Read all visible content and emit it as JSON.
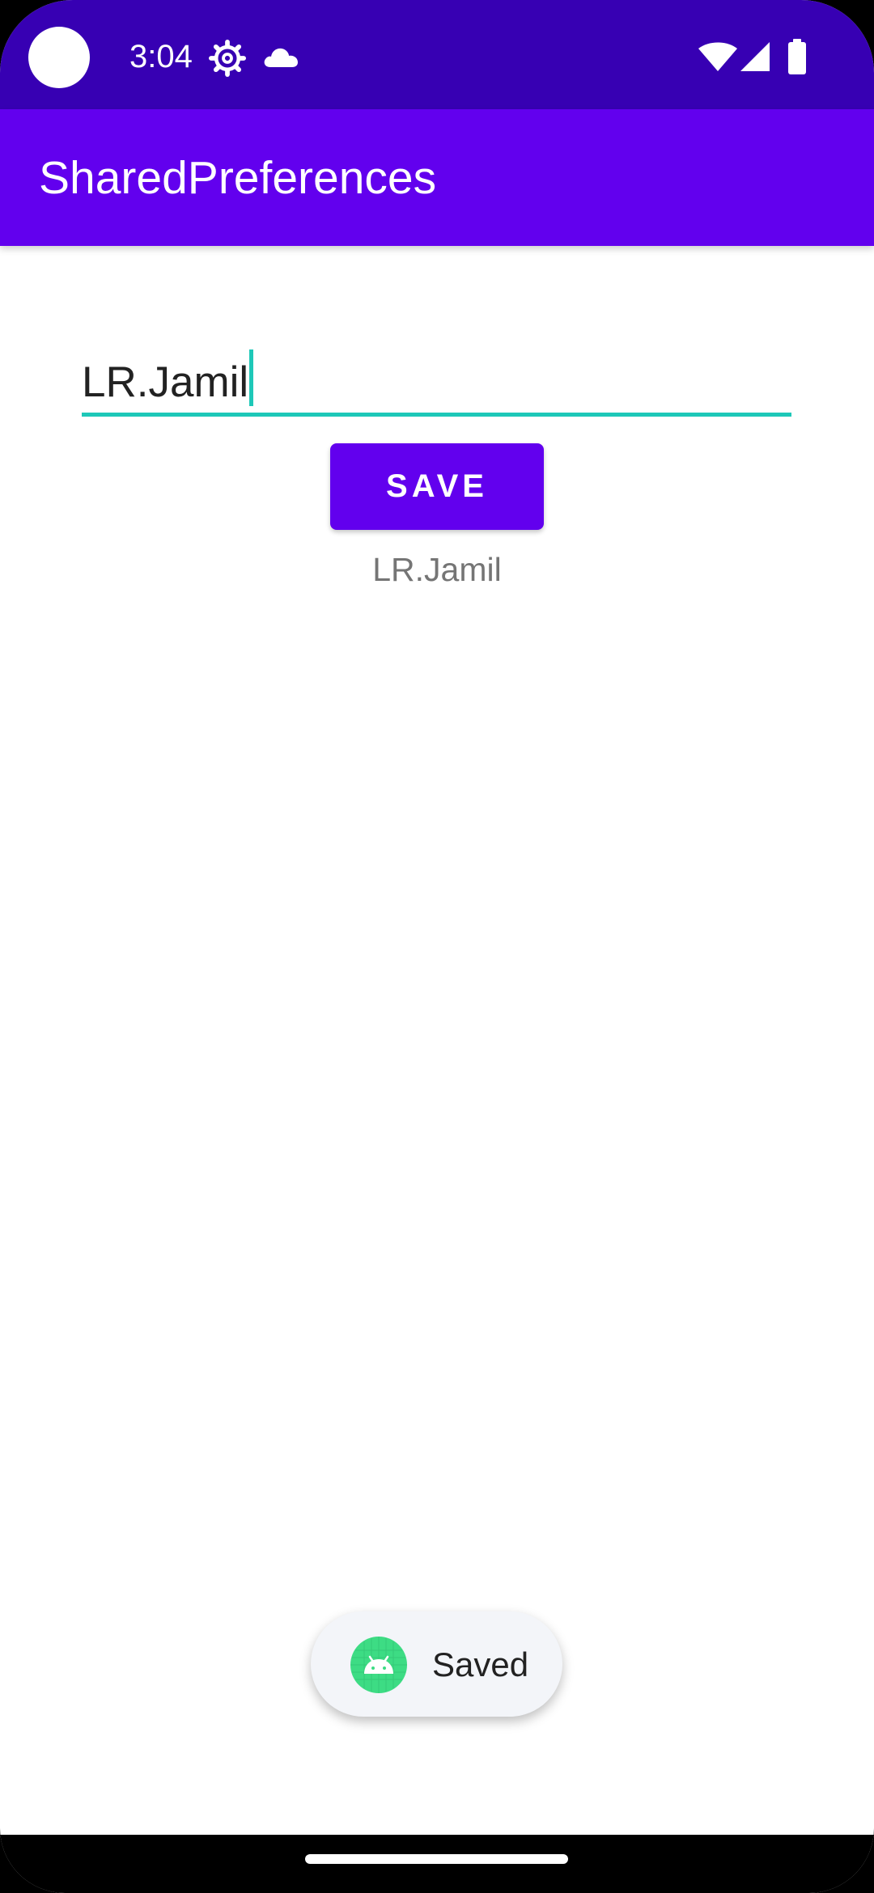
{
  "status_bar": {
    "time": "3:04",
    "background": "#3700b3",
    "icons": [
      "camera-cutout",
      "settings-gear-icon",
      "cloud-icon",
      "wifi-icon",
      "signal-icon",
      "battery-icon"
    ]
  },
  "app_bar": {
    "title": "SharedPreferences",
    "background": "#6200ee"
  },
  "main": {
    "input_value": "LR.Jamil",
    "input_accent": "#1ec8b8",
    "save_button_label": "SAVE",
    "saved_value_text": "LR.Jamil"
  },
  "toast": {
    "icon": "android-icon",
    "message": "Saved"
  },
  "navigation": {
    "handle": "home-gesture-handle"
  }
}
